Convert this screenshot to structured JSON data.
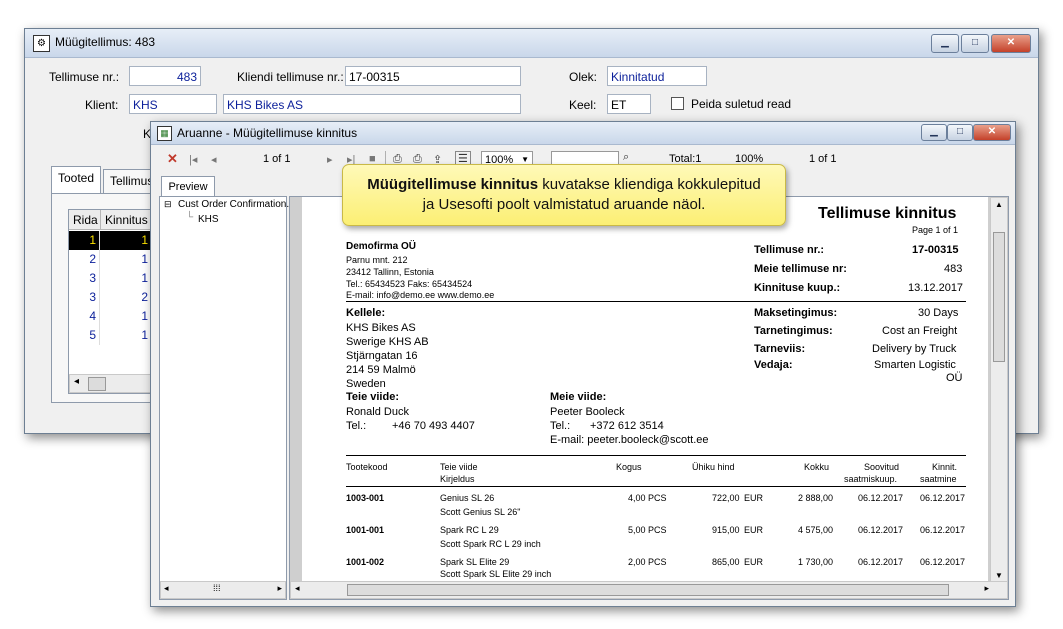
{
  "main_window": {
    "title": "Müügitellimus: 483",
    "order_no_label": "Tellimuse nr.:",
    "order_no_value": "483",
    "client_order_label": "Kliendi tellimuse nr.:",
    "client_order_value": "17-00315",
    "status_label": "Olek:",
    "status_value": "Kinnitatud",
    "client_label": "Klient:",
    "client_code": "KHS",
    "client_name": "KHS Bikes AS",
    "lang_label": "Keel:",
    "lang_value": "ET",
    "hide_closed_label": "Peida suletud read",
    "partial_label": "K",
    "tabs": [
      "Tooted",
      "Tellimus"
    ],
    "grid_headers": [
      "Rida",
      "Kinnitus"
    ],
    "grid_rows": [
      {
        "rida": "1",
        "k": "1"
      },
      {
        "rida": "2",
        "k": "1"
      },
      {
        "rida": "3",
        "k": "1"
      },
      {
        "rida": "3",
        "k": "2"
      },
      {
        "rida": "4",
        "k": "1"
      },
      {
        "rida": "5",
        "k": "1"
      }
    ]
  },
  "report_window": {
    "title": "Aruanne - Müügitellimuse kinnitus",
    "page_indicator": "1 of 1",
    "zoom": "100%",
    "total_label": "Total:1",
    "zoom_status": "100%",
    "page_status": "1 of 1",
    "preview_tab": "Preview",
    "tree_root": "Cust Order Confirmation.",
    "tree_child": "KHS"
  },
  "tooltip": {
    "bold": "Müügitellimuse kinnitus",
    "line1_rest": " kuvatakse kliendiga kokkulepitud",
    "line2": "ja Usesofti poolt valmistatud aruande näol."
  },
  "report": {
    "title": "Tellimuse kinnitus",
    "page_of": "Page 1 of 1",
    "company": "Demofirma OÜ",
    "addr1": "Parnu mnt. 212",
    "addr2": "23412 Tallinn, Estonia",
    "tel": "Tel.:  65434523     Faks: 65434524",
    "email": "E-mail: info@demo.ee        www.demo.ee",
    "order_no_label": "Tellimuse nr.:",
    "order_no_value": "17-00315",
    "our_order_label": "Meie tellimuse nr:",
    "our_order_value": "483",
    "confirm_date_label": "Kinnituse kuup.:",
    "confirm_date_value": "13.12.2017",
    "to_label": "Kellele:",
    "to_lines": [
      "KHS Bikes AS",
      "Swerige KHS AB",
      "Stjärngatan 16",
      "214 59 Malmö",
      "Sweden"
    ],
    "payment_label": "Maksetingimus:",
    "payment_value": "30 Days",
    "delivery_terms_label": "Tarnetingimus:",
    "delivery_terms_value": "Cost an Freight",
    "delivery_method_label": "Tarneviis:",
    "delivery_method_value": "Delivery by Truck",
    "carrier_label": "Vedaja:",
    "carrier_value1": "Smarten Logistic",
    "carrier_value2": "OÜ",
    "your_ref_label": "Teie viide:",
    "your_ref_name": "Ronald Duck",
    "your_ref_tel_label": "Tel.:",
    "your_ref_tel": "+46 70 493 4407",
    "our_ref_label": "Meie viide:",
    "our_ref_name": "Peeter Booleck",
    "our_ref_tel_label": "Tel.:",
    "our_ref_tel": "+372 612 3514",
    "our_ref_email": "E-mail: peeter.booleck@scott.ee",
    "col_code": "Tootekood",
    "col_ref": "Teie viide",
    "col_desc": "Kirjeldus",
    "col_qty": "Kogus",
    "col_unit_price": "Ühiku hind",
    "col_total": "Kokku",
    "col_wish1": "Soovitud",
    "col_wish2": "saatmiskuup.",
    "col_conf1": "Kinnit.",
    "col_conf2": "saatmine",
    "lines": [
      {
        "code": "1003-001",
        "name": "Genius SL 26",
        "desc": "Scott Genius SL 26\"",
        "qty": "4,00",
        "unit": "PCS",
        "price": "722,00",
        "cur": "EUR",
        "total": "2 888,00",
        "wish": "06.12.2017",
        "conf": "06.12.2017"
      },
      {
        "code": "1001-001",
        "name": "Spark RC L 29",
        "desc": "Scott Spark RC L 29 inch",
        "qty": "5,00",
        "unit": "PCS",
        "price": "915,00",
        "cur": "EUR",
        "total": "4 575,00",
        "wish": "06.12.2017",
        "conf": "06.12.2017"
      },
      {
        "code": "1001-002",
        "name": "Spark SL Elite 29",
        "desc": "Scott Spark SL Elite 29 inch",
        "qty": "2,00",
        "unit": "PCS",
        "price": "865,00",
        "cur": "EUR",
        "total": "1 730,00",
        "wish": "06.12.2017",
        "conf": "06.12.2017"
      }
    ]
  }
}
